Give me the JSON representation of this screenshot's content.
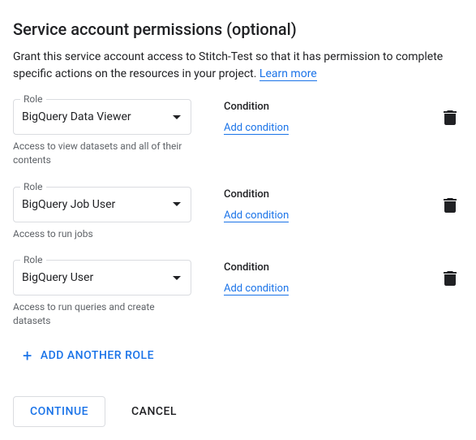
{
  "title": "Service account permissions (optional)",
  "description": "Grant this service account access to Stitch-Test so that it has permission to complete specific actions on the resources in your project. ",
  "learn_more": "Learn more",
  "role_label": "Role",
  "condition_label": "Condition",
  "add_condition": "Add condition",
  "add_another": "ADD ANOTHER ROLE",
  "continue": "CONTINUE",
  "cancel": "CANCEL",
  "roles": [
    {
      "value": "BigQuery Data Viewer",
      "hint": "Access to view datasets and all of their contents"
    },
    {
      "value": "BigQuery Job User",
      "hint": "Access to run jobs"
    },
    {
      "value": "BigQuery User",
      "hint": "Access to run queries and create datasets"
    }
  ]
}
